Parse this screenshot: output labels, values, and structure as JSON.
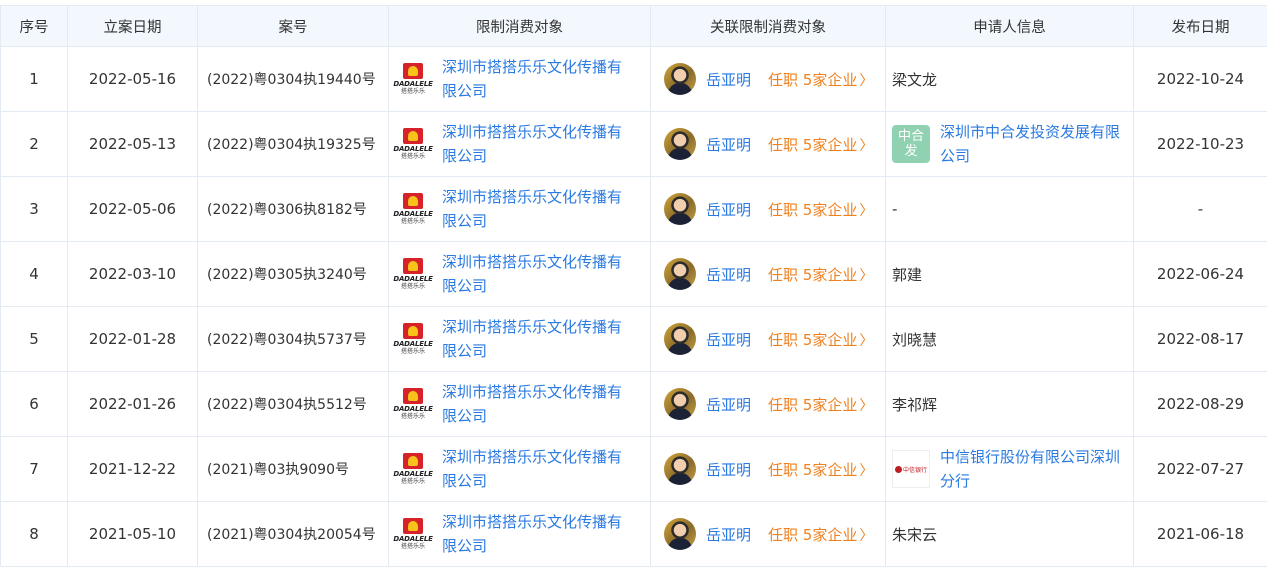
{
  "headers": [
    "序号",
    "立案日期",
    "案号",
    "限制消费对象",
    "关联限制消费对象",
    "申请人信息",
    "发布日期"
  ],
  "logo_text": {
    "brand": "DADALELE",
    "sub": "搭搭乐乐"
  },
  "citic_logo_text": "中信银行",
  "rows": [
    {
      "no": "1",
      "filed": "2022-05-16",
      "case": "(2022)粤0304执19440号",
      "company_l1": "深圳市搭搭乐乐文化传播有",
      "company_l2": "限公司",
      "person": "岳亚明",
      "tenure": "任职 5家企业",
      "applicant_type": "text",
      "applicant": "梁文龙",
      "published": "2022-10-24"
    },
    {
      "no": "2",
      "filed": "2022-05-13",
      "case": "(2022)粤0304执19325号",
      "company_l1": "深圳市搭搭乐乐文化传播有",
      "company_l2": "限公司",
      "person": "岳亚明",
      "tenure": "任职 5家企业",
      "applicant_type": "zhf",
      "badge": "中合发",
      "applicant_l1": "深圳市中合发投资发展有限",
      "applicant_l2": "公司",
      "published": "2022-10-23"
    },
    {
      "no": "3",
      "filed": "2022-05-06",
      "case": "(2022)粤0306执8182号",
      "company_l1": "深圳市搭搭乐乐文化传播有",
      "company_l2": "限公司",
      "person": "岳亚明",
      "tenure": "任职 5家企业",
      "applicant_type": "text",
      "applicant": "-",
      "published": "-"
    },
    {
      "no": "4",
      "filed": "2022-03-10",
      "case": "(2022)粤0305执3240号",
      "company_l1": "深圳市搭搭乐乐文化传播有",
      "company_l2": "限公司",
      "person": "岳亚明",
      "tenure": "任职 5家企业",
      "applicant_type": "text",
      "applicant": "郭建",
      "published": "2022-06-24"
    },
    {
      "no": "5",
      "filed": "2022-01-28",
      "case": "(2022)粤0304执5737号",
      "company_l1": "深圳市搭搭乐乐文化传播有",
      "company_l2": "限公司",
      "person": "岳亚明",
      "tenure": "任职 5家企业",
      "applicant_type": "text",
      "applicant": "刘晓慧",
      "published": "2022-08-17"
    },
    {
      "no": "6",
      "filed": "2022-01-26",
      "case": "(2022)粤0304执5512号",
      "company_l1": "深圳市搭搭乐乐文化传播有",
      "company_l2": "限公司",
      "person": "岳亚明",
      "tenure": "任职 5家企业",
      "applicant_type": "text",
      "applicant": "李祁辉",
      "published": "2022-08-29"
    },
    {
      "no": "7",
      "filed": "2021-12-22",
      "case": "(2021)粤03执9090号",
      "company_l1": "深圳市搭搭乐乐文化传播有",
      "company_l2": "限公司",
      "person": "岳亚明",
      "tenure": "任职 5家企业",
      "applicant_type": "citic",
      "applicant_l1": "中信银行股份有限公司深圳",
      "applicant_l2": "分行",
      "published": "2022-07-27"
    },
    {
      "no": "8",
      "filed": "2021-05-10",
      "case": "(2021)粤0304执20054号",
      "company_l1": "深圳市搭搭乐乐文化传播有",
      "company_l2": "限公司",
      "person": "岳亚明",
      "tenure": "任职 5家企业",
      "applicant_type": "text",
      "applicant": "朱宋云",
      "published": "2021-06-18"
    }
  ]
}
